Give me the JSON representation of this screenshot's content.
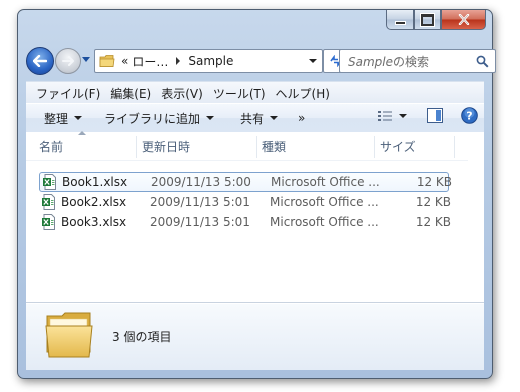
{
  "window": {
    "address": {
      "overflow": "«",
      "crumb_1": "ロー…",
      "crumb_2": "Sample"
    },
    "search": {
      "placeholder_italic": "Sample",
      "placeholder_rest": "の検索"
    }
  },
  "menu": [
    "ファイル(F)",
    "編集(E)",
    "表示(V)",
    "ツール(T)",
    "ヘルプ(H)"
  ],
  "toolbar": {
    "organize": "整理",
    "library": "ライブラリに追加",
    "share": "共有",
    "more": "»"
  },
  "columns": {
    "name": "名前",
    "modified": "更新日時",
    "type": "種類",
    "size": "サイズ"
  },
  "files": [
    {
      "name": "Book1.xlsx",
      "modified": "2009/11/13 5:00",
      "type": "Microsoft Office ...",
      "size": "12 KB",
      "selected": true
    },
    {
      "name": "Book2.xlsx",
      "modified": "2009/11/13 5:01",
      "type": "Microsoft Office ...",
      "size": "12 KB",
      "selected": false
    },
    {
      "name": "Book3.xlsx",
      "modified": "2009/11/13 5:01",
      "type": "Microsoft Office ...",
      "size": "12 KB",
      "selected": false
    }
  ],
  "details": {
    "count_text": "3 個の項目"
  },
  "icons": {
    "back": "back-arrow-icon",
    "forward": "forward-arrow-icon",
    "folder": "folder-icon",
    "refresh": "refresh-icon",
    "search": "search-icon",
    "view": "view-options-icon",
    "preview": "preview-pane-icon",
    "help": "help-icon",
    "file": "excel-file-icon"
  },
  "colors": {
    "accent": "#2a64c4",
    "selection_border": "#7da2ce",
    "close_button": "#c2442c"
  }
}
